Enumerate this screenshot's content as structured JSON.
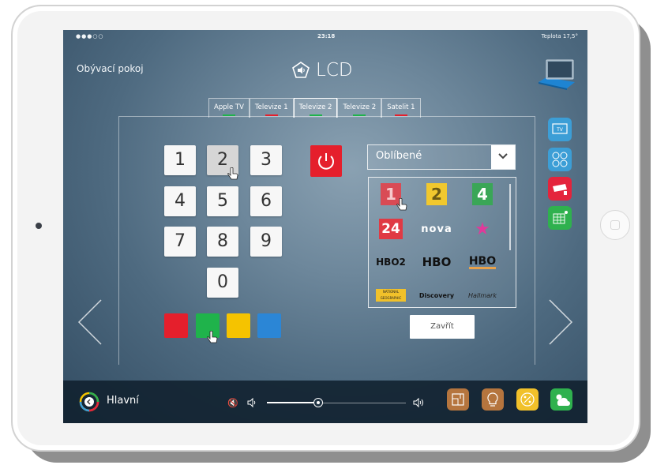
{
  "status_bar": {
    "signal": "●●●○○",
    "time": "23:18",
    "temperature": "Teplota 17,5°"
  },
  "room": "Obývací pokoj",
  "device": {
    "title": "LCD",
    "icon": "speaker-icon"
  },
  "tabs": [
    {
      "label": "Apple TV",
      "underline": "#1fb34b"
    },
    {
      "label": "Televize 1",
      "underline": "#e51f2c"
    },
    {
      "label": "Televize 2",
      "underline": "#1fb34b",
      "active": true
    },
    {
      "label": "Televize 2",
      "underline": "#1fb34b"
    },
    {
      "label": "Satelit 1",
      "underline": "#e51f2c"
    }
  ],
  "keypad": [
    "1",
    "2",
    "3",
    "4",
    "5",
    "6",
    "7",
    "8",
    "9",
    "0"
  ],
  "pressed_key": "2",
  "color_buttons": [
    "#e51f2c",
    "#1fb34b",
    "#f5c300",
    "#2b86d6"
  ],
  "favorites": {
    "select_label": "Oblíbené",
    "channels": [
      {
        "name": "CT1",
        "text": "1"
      },
      {
        "name": "CT2",
        "text": "2"
      },
      {
        "name": "CT Sport",
        "text": "4"
      },
      {
        "name": "CT24",
        "text": "24"
      },
      {
        "name": "Nova",
        "text": "nova"
      },
      {
        "name": "Prima Cool",
        "text": "★"
      },
      {
        "name": "HBO2",
        "text": "HBO2"
      },
      {
        "name": "HBO",
        "text": "HBO"
      },
      {
        "name": "HBO Comedy",
        "text": "HBO"
      },
      {
        "name": "National Geographic",
        "text": "NATIONAL GEOGRAPHIC"
      },
      {
        "name": "Discovery",
        "text": "Discovery"
      },
      {
        "name": "Hallmark",
        "text": "Hallmark"
      }
    ],
    "close_label": "Zavřít"
  },
  "side_menu": [
    "tv-icon",
    "camera-grid-icon",
    "camera-icon",
    "solar-panel-icon"
  ],
  "bottom_bar": {
    "home_label": "Hlavní",
    "volume_level": 0.37,
    "mute_symbol": "🔇",
    "buttons": [
      "map-icon",
      "bulb-icon",
      "percent-icon",
      "weather-icon"
    ]
  },
  "colors": {
    "accent_red": "#e51f2c",
    "accent_green": "#1fb34b",
    "accent_yellow": "#f5c300",
    "accent_blue": "#2b86d6"
  }
}
